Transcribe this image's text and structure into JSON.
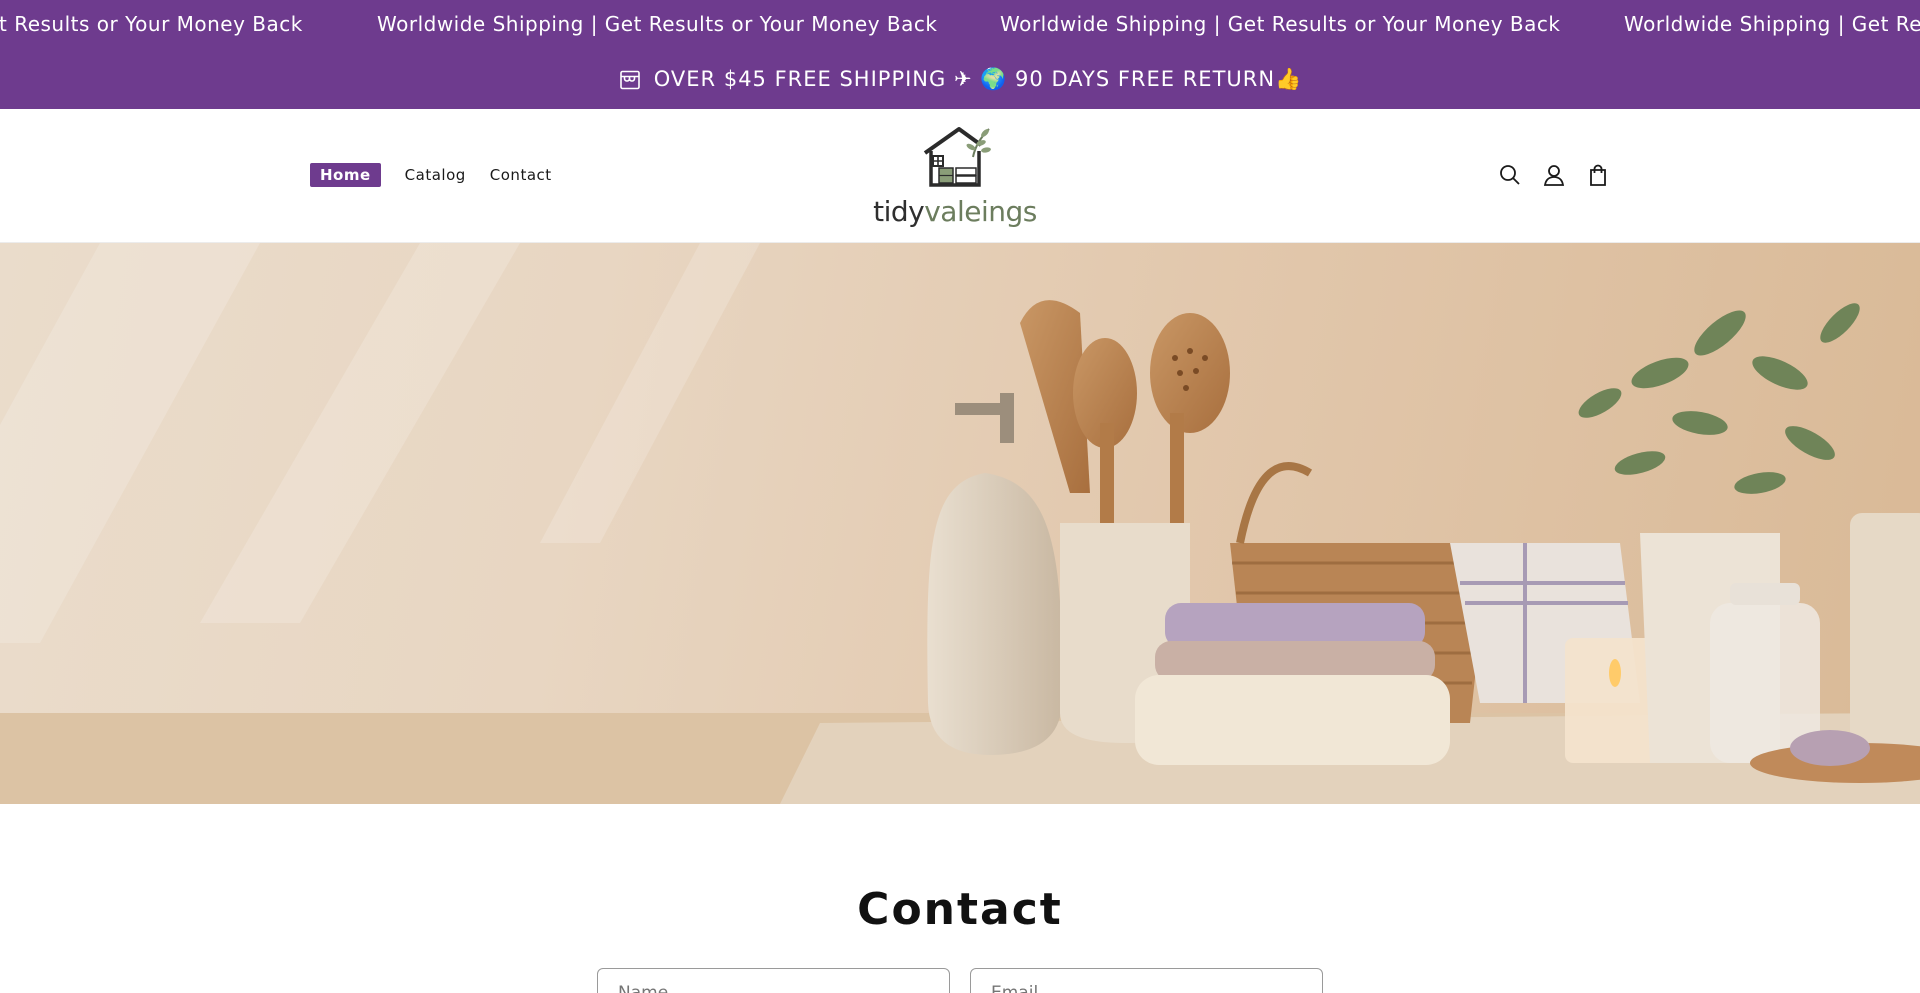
{
  "marquee": {
    "text": "Worldwide Shipping | Get Results or Your Money Back",
    "partial_left": "t Results or Your Money Back",
    "partial_right": "Worldwide Shipping | Get Resu"
  },
  "announcement": {
    "icon": "store-icon",
    "text": "OVER $45 FREE SHIPPING ✈ 🌍 90 DAYS FREE RETURN👍"
  },
  "nav": {
    "items": [
      {
        "label": "Home",
        "active": true
      },
      {
        "label": "Catalog",
        "active": false
      },
      {
        "label": "Contact",
        "active": false
      }
    ]
  },
  "logo": {
    "part1": "tidy",
    "part2": "valeings"
  },
  "header_icons": [
    "search-icon",
    "account-icon",
    "cart-icon"
  ],
  "contact": {
    "title": "Contact",
    "name_placeholder": "Name",
    "email_placeholder": "Email"
  },
  "colors": {
    "brand_purple": "#6e3b8e",
    "logo_green": "#6c7d5e"
  }
}
